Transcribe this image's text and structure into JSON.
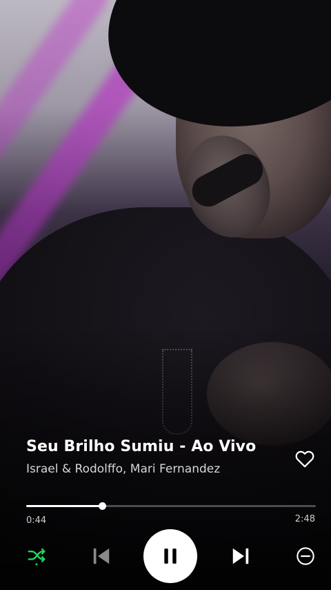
{
  "track": {
    "title": "Seu Brilho Sumiu - Ao Vivo",
    "artist": "Israel & Rodolffo, Mari Fernandez",
    "liked": false
  },
  "playback": {
    "elapsed": "0:44",
    "duration": "2:48",
    "progress_fraction": 0.262,
    "state": "playing",
    "shuffle": true
  },
  "icons": {
    "like": "heart-outline-icon",
    "shuffle": "shuffle-icon",
    "previous": "skip-previous-icon",
    "play_pause": "pause-icon",
    "next": "skip-next-icon",
    "remove": "minus-circle-icon"
  },
  "colors": {
    "accent": "#1ed760",
    "text_primary": "#ffffff",
    "text_secondary": "#d7d7d7"
  }
}
